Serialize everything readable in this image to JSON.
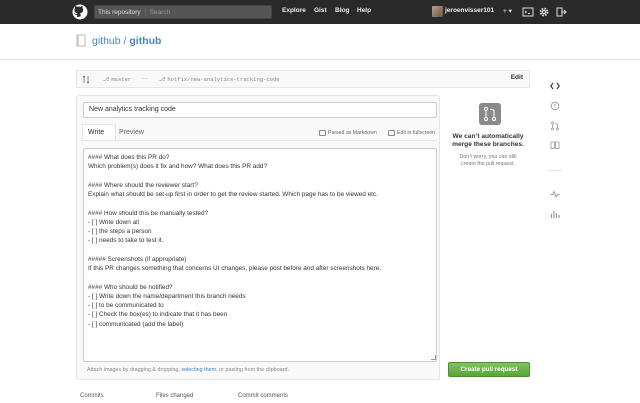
{
  "topbar": {
    "search_scope": "This repository",
    "search_placeholder": "Search",
    "nav": [
      "Explore",
      "Gist",
      "Blog",
      "Help"
    ],
    "username": "jeroenvisser101",
    "plus_label": "+ ▾"
  },
  "repo": {
    "owner": "github",
    "separator": " / ",
    "name": "github"
  },
  "branches": {
    "base": "master",
    "dots": "...",
    "head": "hotfix/new-analytics-tracking-code",
    "edit_label": "Edit"
  },
  "form": {
    "title_value": "New analytics tracking code",
    "tab_write": "Write",
    "tab_preview": "Preview",
    "parsed_as_markdown": "Parsed as Markdown",
    "edit_fullscreen": "Edit in fullscreen",
    "body_lines": [
      "#### What does this PR do?",
      "Which problem(s) does it fix and how? What does this PR add?",
      "",
      "#### Where should the reviewer start?",
      "Explain what should be set-up first in order to get the review started. Which page has to be viewed etc.",
      "",
      "#### How should this be manually tested?",
      "- [ ] Write down all",
      "- [ ] the steps a person",
      "- [ ] needs to take to test it.",
      "",
      "##### Screenshots (if appropriate)",
      "If this PR changes something that concerns UI changes, please post before and after screenshots here.",
      "",
      "#### Who should be notified?",
      "- [ ] Write down the name/department this branch needs",
      "- [ ] to be communicated to",
      "- [ ] Check the box(es) to indicate that it has been",
      "- [ ] communicated (add the label)"
    ],
    "attach_prefix": "Attach images by dragging & dropping, ",
    "attach_link": "selecting them",
    "attach_suffix": ", or pasting from the clipboard."
  },
  "merge_status": {
    "title_line1": "We can’t automatically",
    "title_line2": "merge these branches.",
    "sub_line1": "Don’t worry, you can still",
    "sub_line2": "create the pull request."
  },
  "create_button": "Create pull request",
  "bottom_tabs": [
    "Commits",
    "Files changed",
    "Commit comments"
  ],
  "colors": {
    "header_bg": "#2a2a2a",
    "link": "#4183c4",
    "green_button": "#6cc644"
  }
}
